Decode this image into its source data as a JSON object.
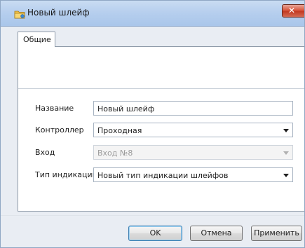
{
  "window": {
    "title": "Новый шлейф",
    "title_icon": "folder-icon",
    "close_label": "✕"
  },
  "tabs": [
    {
      "label": "Общие",
      "active": true
    }
  ],
  "form": {
    "name": {
      "label": "Название",
      "value": "Новый шлейф"
    },
    "controller": {
      "label": "Контроллер",
      "value": "Проходная"
    },
    "input": {
      "label": "Вход",
      "value": "Вход №8",
      "disabled": true
    },
    "indication": {
      "label": "Тип индикации",
      "value": "Новый тип индикации шлейфов"
    }
  },
  "buttons": {
    "ok": "OK",
    "cancel": "Отмена",
    "apply": "Применить"
  }
}
